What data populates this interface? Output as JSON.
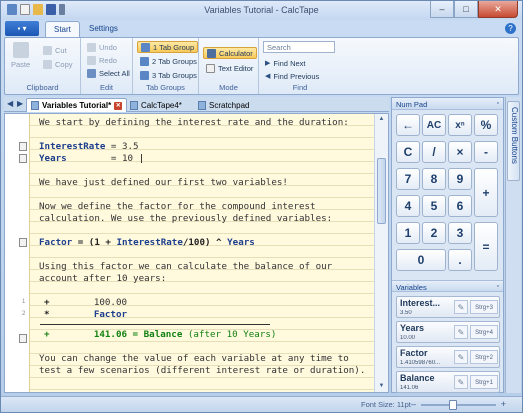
{
  "window": {
    "title": "Variables Tutorial - CalcTape",
    "controls": [
      "–",
      "□",
      "✕"
    ]
  },
  "ribbon": {
    "app_button": "▪ ▾",
    "tabs": [
      "Start",
      "Settings"
    ],
    "groups": {
      "clipboard": {
        "label": "Clipboard",
        "paste": "Paste",
        "cut": "Cut",
        "copy": "Copy"
      },
      "edit": {
        "label": "Edit",
        "undo": "Undo",
        "redo": "Redo",
        "select_all": "Select All"
      },
      "tab_groups": {
        "label": "Tab Groups",
        "one": "1 Tab Group",
        "two": "2 Tab Groups",
        "three": "3 Tab Groups"
      },
      "mode": {
        "label": "Mode",
        "calculator": "Calculator",
        "text_editor": "Text Editor"
      },
      "find": {
        "label": "Find",
        "search_placeholder": "Search",
        "next": "Find Next",
        "previous": "Find Previous"
      }
    }
  },
  "doc_tabs": [
    {
      "label": "Variables Tutorial*",
      "active": true
    },
    {
      "label": "CalcTape4*",
      "active": false
    },
    {
      "label": "Scratchpad",
      "active": false
    }
  ],
  "editor": {
    "l1": "We start by defining the interest rate and the duration:",
    "l3a_name": "InterestRate",
    "l3a_rest": " = 3.5",
    "l3b_name": "Years",
    "l3b_rest": "        = 10",
    "l5": "We have just defined our first two variables!",
    "l7": "Now we define the factor for the compound interest",
    "l8": "calculation. We use the previously defined variables:",
    "l10_name": "Factor",
    "l10_rest": " = (1 + ",
    "l10_v1": "InterestRate",
    "l10_mid": "/100) ^ ",
    "l10_v2": "Years",
    "l12": "Using this factor we can calculate the balance of our",
    "l13": "account after 10 years:",
    "c1_op": "+",
    "c1_val": "100.00",
    "c2_op": "*",
    "c2_val": "Factor",
    "r_op": "+",
    "r_val": "141.06",
    "r_eq": " = ",
    "r_name": "Balance",
    "r_note": " (after 10 Years)",
    "l19": "You can change the value of each variable at any time to",
    "l20": "test a few scenarios (different interest rate or duration).",
    "gutter_numbers": [
      "1",
      "2"
    ]
  },
  "numpad": {
    "title": "Num Pad",
    "keys": {
      "back": "←",
      "ac": "AC",
      "xn": "xⁿ",
      "pct": "%",
      "c": "C",
      "div": "/",
      "mul": "×",
      "minus": "-",
      "n7": "7",
      "n8": "8",
      "n9": "9",
      "plus": "+",
      "n4": "4",
      "n5": "5",
      "n6": "6",
      "n1": "1",
      "n2": "2",
      "n3": "3",
      "eq": "=",
      "n0": "0",
      "dot": "."
    }
  },
  "variables": {
    "title": "Variables",
    "items": [
      {
        "name": "Interest...",
        "value": "3.50",
        "shortcut": "Strg+3"
      },
      {
        "name": "Years",
        "value": "10.00",
        "shortcut": "Strg+4"
      },
      {
        "name": "Factor",
        "value": "1.410598760...",
        "shortcut": "Strg+2"
      },
      {
        "name": "Balance",
        "value": "141.06",
        "shortcut": "Strg+1"
      }
    ]
  },
  "side_panel": {
    "label": "Custom Buttons"
  },
  "status": {
    "font_size": "Font Size: 11pt",
    "zoom_minus": "–",
    "zoom_plus": "+",
    "zoom_level": 0.42
  }
}
